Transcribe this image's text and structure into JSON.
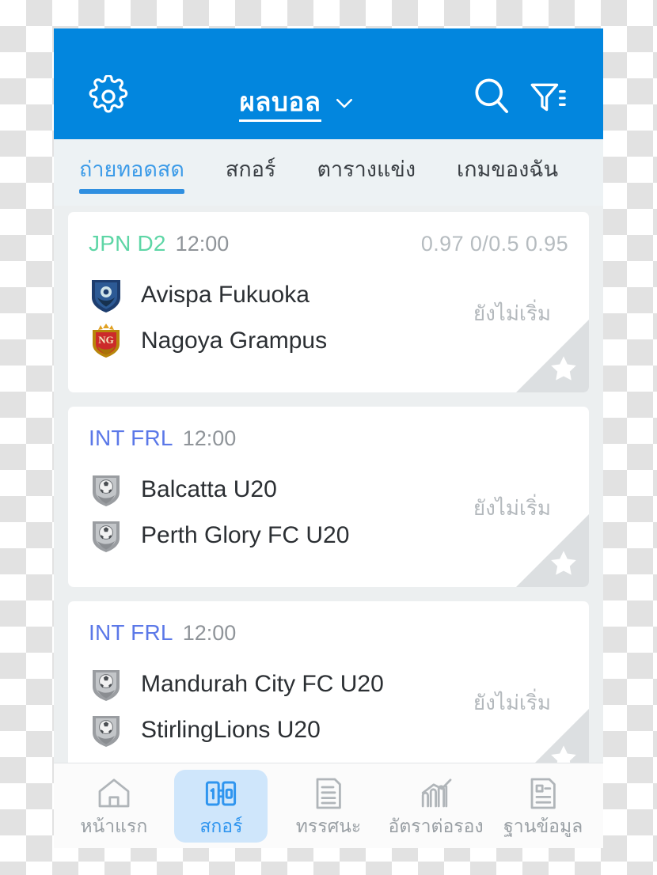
{
  "header": {
    "title": "ผลบอล",
    "settings_icon": "gear-icon",
    "dropdown_icon": "chevron-down-icon",
    "search_icon": "search-icon",
    "filter_icon": "filter-icon",
    "background_color": "#0286DE"
  },
  "tabs": [
    {
      "label": "ถ่ายทอดสด",
      "active": true
    },
    {
      "label": "สกอร์",
      "active": false
    },
    {
      "label": "ตารางแข่ง",
      "active": false
    },
    {
      "label": "เกมของฉัน",
      "active": false
    }
  ],
  "matches": [
    {
      "league": "JPN D2",
      "league_color": "#5ED6A6",
      "time": "12:00",
      "odds": "0.97 0/0.5 0.95",
      "status": "ยังไม่เริ่ม",
      "home": {
        "name": "Avispa Fukuoka",
        "crest": "avispa-fukuoka-crest"
      },
      "away": {
        "name": "Nagoya Grampus",
        "crest": "nagoya-grampus-crest"
      },
      "favorite_icon": "star-icon"
    },
    {
      "league": "INT FRL",
      "league_color": "#5B78E8",
      "time": "12:00",
      "odds": "",
      "status": "ยังไม่เริ่ม",
      "home": {
        "name": "Balcatta U20",
        "crest": "default-shield-crest"
      },
      "away": {
        "name": "Perth Glory FC U20",
        "crest": "default-shield-crest"
      },
      "favorite_icon": "star-icon"
    },
    {
      "league": "INT FRL",
      "league_color": "#5B78E8",
      "time": "12:00",
      "odds": "",
      "status": "ยังไม่เริ่ม",
      "home": {
        "name": "Mandurah City FC U20",
        "crest": "default-shield-crest"
      },
      "away": {
        "name": "StirlingLions U20",
        "crest": "default-shield-crest"
      },
      "favorite_icon": "star-icon"
    }
  ],
  "bottom_nav": {
    "active_color": "#2f95ef",
    "active_background": "#cfe6fb",
    "items": [
      {
        "label": "หน้าแรก",
        "icon": "home-icon",
        "active": false
      },
      {
        "label": "สกอร์",
        "icon": "scoreboard-icon",
        "active": true,
        "icon_text": "1:0"
      },
      {
        "label": "ทรรศนะ",
        "icon": "document-icon",
        "active": false
      },
      {
        "label": "อัตราต่อรอง",
        "icon": "chart-icon",
        "active": false
      },
      {
        "label": "ฐานข้อมูล",
        "icon": "database-icon",
        "active": false
      }
    ]
  }
}
